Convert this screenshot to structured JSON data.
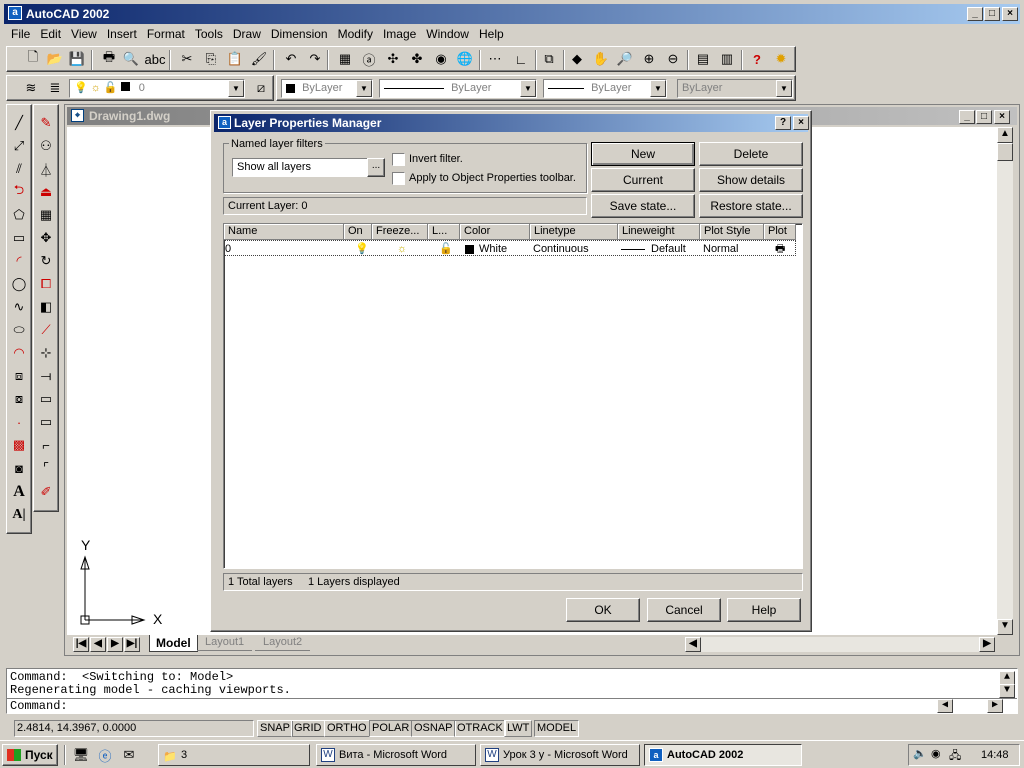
{
  "app": {
    "title": "AutoCAD 2002"
  },
  "menu": [
    "File",
    "Edit",
    "View",
    "Insert",
    "Format",
    "Tools",
    "Draw",
    "Dimension",
    "Modify",
    "Image",
    "Window",
    "Help"
  ],
  "layer_toolbar": {
    "current_layer": "0",
    "color": "ByLayer",
    "linetype": "ByLayer",
    "lineweight": "ByLayer",
    "plotstyle": "ByLayer"
  },
  "drawing": {
    "title": "Drawing1.dwg",
    "ucs_y": "Y",
    "ucs_x": "X",
    "tabs": [
      "Model",
      "Layout1",
      "Layout2"
    ]
  },
  "dialog": {
    "title": "Layer Properties Manager",
    "filters_legend": "Named layer filters",
    "filter_value": "Show all layers",
    "browse_label": "...",
    "invert_filter": "Invert filter.",
    "apply_toolbar": "Apply to Object Properties toolbar.",
    "current_layer": "Current Layer:  0",
    "buttons": {
      "new": "New",
      "delete": "Delete",
      "current": "Current",
      "show_details": "Show details",
      "save_state": "Save state...",
      "restore_state": "Restore state...",
      "ok": "OK",
      "cancel": "Cancel",
      "help": "Help"
    },
    "columns": [
      "Name",
      "On",
      "Freeze...",
      "L...",
      "Color",
      "Linetype",
      "Lineweight",
      "Plot Style",
      "Plot"
    ],
    "rows": [
      {
        "name": "0",
        "color": "White",
        "linetype": "Continuous",
        "lineweight": "Default",
        "plot_style": "Normal"
      }
    ],
    "status_total": "1 Total layers",
    "status_displayed": "1 Layers displayed"
  },
  "command": {
    "line1": "Command:  <Switching to: Model>",
    "line2": "Regenerating model - caching viewports.",
    "prompt": "Command:"
  },
  "status": {
    "coords": "2.4814, 14.3967, 0.0000",
    "buttons": [
      "SNAP",
      "GRID",
      "ORTHO",
      "POLAR",
      "OSNAP",
      "OTRACK",
      "LWT",
      "MODEL"
    ]
  },
  "taskbar": {
    "start": "Пуск",
    "folder": "3",
    "tasks": [
      "Вита - Microsoft Word",
      "Урок 3 у - Microsoft Word",
      "AutoCAD 2002"
    ],
    "time": "14:48"
  },
  "colors": {
    "title_active": "#0a246a",
    "title_gradient_end": "#a6caf0",
    "face": "#d4d0c8"
  }
}
